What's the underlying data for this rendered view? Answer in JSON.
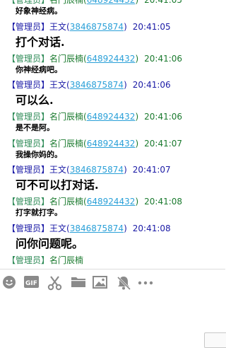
{
  "colors": {
    "admin_tag": "#2e8b57",
    "wangwen": "#1a1aa6",
    "mingmen": "#1a7a2e",
    "qq_link": "#2aa0d8",
    "toolbar_icon": "#8a8a8a"
  },
  "messages": [
    {
      "role": "【管理员】",
      "name": "名门辰楠",
      "qq_open": "(",
      "qq": "648924432",
      "qq_close": ")",
      "time": "20:41:05",
      "text": "好象神经病。",
      "sender": "mingmen",
      "size": "small"
    },
    {
      "role": "【管理员】",
      "name": "王文",
      "qq_open": "(",
      "qq": "3846875874",
      "qq_close": ")",
      "time": "20:41:05",
      "text": "打个对话.",
      "sender": "wangwen",
      "size": "big"
    },
    {
      "role": "【管理员】",
      "name": "名门辰楠",
      "qq_open": "(",
      "qq": "648924432",
      "qq_close": ")",
      "time": "20:41:06",
      "text": "你神经病吧。",
      "sender": "mingmen",
      "size": "small"
    },
    {
      "role": "【管理员】",
      "name": "王文",
      "qq_open": "(",
      "qq": "3846875874",
      "qq_close": ")",
      "time": "20:41:06",
      "text": "可以么.",
      "sender": "wangwen",
      "size": "big"
    },
    {
      "role": "【管理员】",
      "name": "名门辰楠",
      "qq_open": "(",
      "qq": "648924432",
      "qq_close": ")",
      "time": "20:41:06",
      "text": "是不是阿。",
      "sender": "mingmen",
      "size": "small"
    },
    {
      "role": "【管理员】",
      "name": "名门辰楠",
      "qq_open": "(",
      "qq": "648924432",
      "qq_close": ")",
      "time": "20:41:07",
      "text": "我操你妈的。",
      "sender": "mingmen",
      "size": "small"
    },
    {
      "role": "【管理员】",
      "name": "王文",
      "qq_open": "(",
      "qq": "3846875874",
      "qq_close": ")",
      "time": "20:41:07",
      "text": "可不可以打对话.",
      "sender": "wangwen",
      "size": "big"
    },
    {
      "role": "【管理员】",
      "name": "名门辰楠",
      "qq_open": "(",
      "qq": "648924432",
      "qq_close": ")",
      "time": "20:41:08",
      "text": "打字就打字。",
      "sender": "mingmen",
      "size": "small"
    },
    {
      "role": "【管理员】",
      "name": "王文",
      "qq_open": "(",
      "qq": "3846875874",
      "qq_close": ")",
      "time": "20:41:08",
      "text": "问你问题呢。",
      "sender": "wangwen",
      "size": "big"
    },
    {
      "role": "【管理员】",
      "name": "名门辰楠",
      "qq_open": "",
      "qq": "",
      "qq_close": "",
      "time": "",
      "text": "",
      "sender": "mingmen",
      "size": "small"
    }
  ],
  "toolbar": {
    "items": [
      {
        "icon": "emoji-icon"
      },
      {
        "icon": "gif-icon",
        "label": "GIF"
      },
      {
        "icon": "scissors-icon"
      },
      {
        "icon": "folder-icon"
      },
      {
        "icon": "image-icon"
      },
      {
        "icon": "bell-off-icon"
      },
      {
        "icon": "more-icon"
      }
    ]
  }
}
